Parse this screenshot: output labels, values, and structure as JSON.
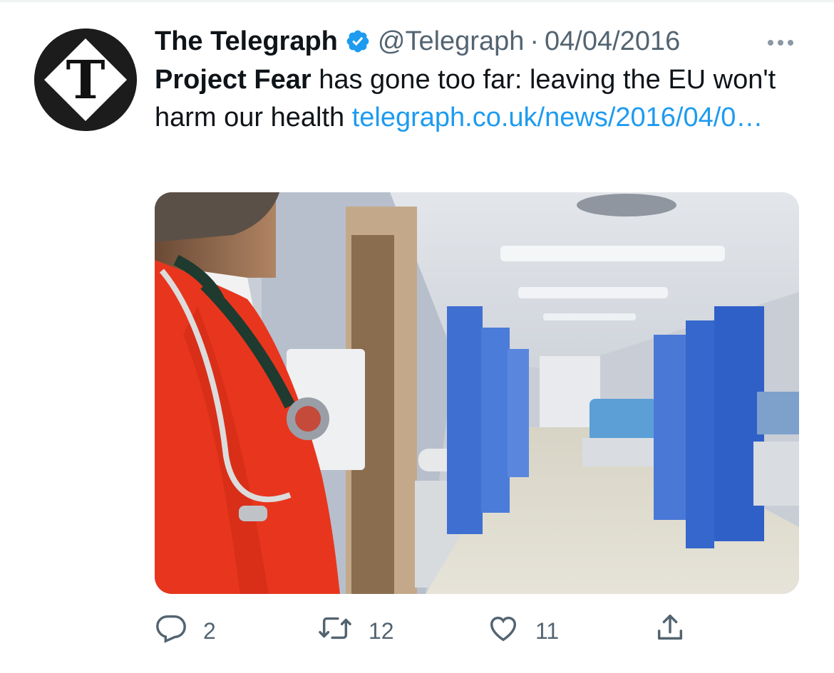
{
  "tweet": {
    "author_name": "The Telegraph",
    "handle": "@Telegraph",
    "separator": "·",
    "date": "04/04/2016",
    "text_bold": "Project Fear",
    "text_body": " has gone too far: leaving the EU won't harm our health ",
    "link_text": "telegraph.co.uk/news/2016/04/0…",
    "avatar_letter": "T"
  },
  "actions": {
    "reply_count": "2",
    "retweet_count": "12",
    "like_count": "11"
  },
  "colors": {
    "link": "#1d9bf0",
    "verified": "#1d9bf0",
    "secondary_text": "#536471",
    "scrub_red": "#e8361e",
    "curtain_blue": "#3f6fd1"
  },
  "icons": [
    "verified-badge-icon",
    "more-options-icon",
    "reply-icon",
    "retweet-icon",
    "like-icon",
    "share-icon"
  ]
}
